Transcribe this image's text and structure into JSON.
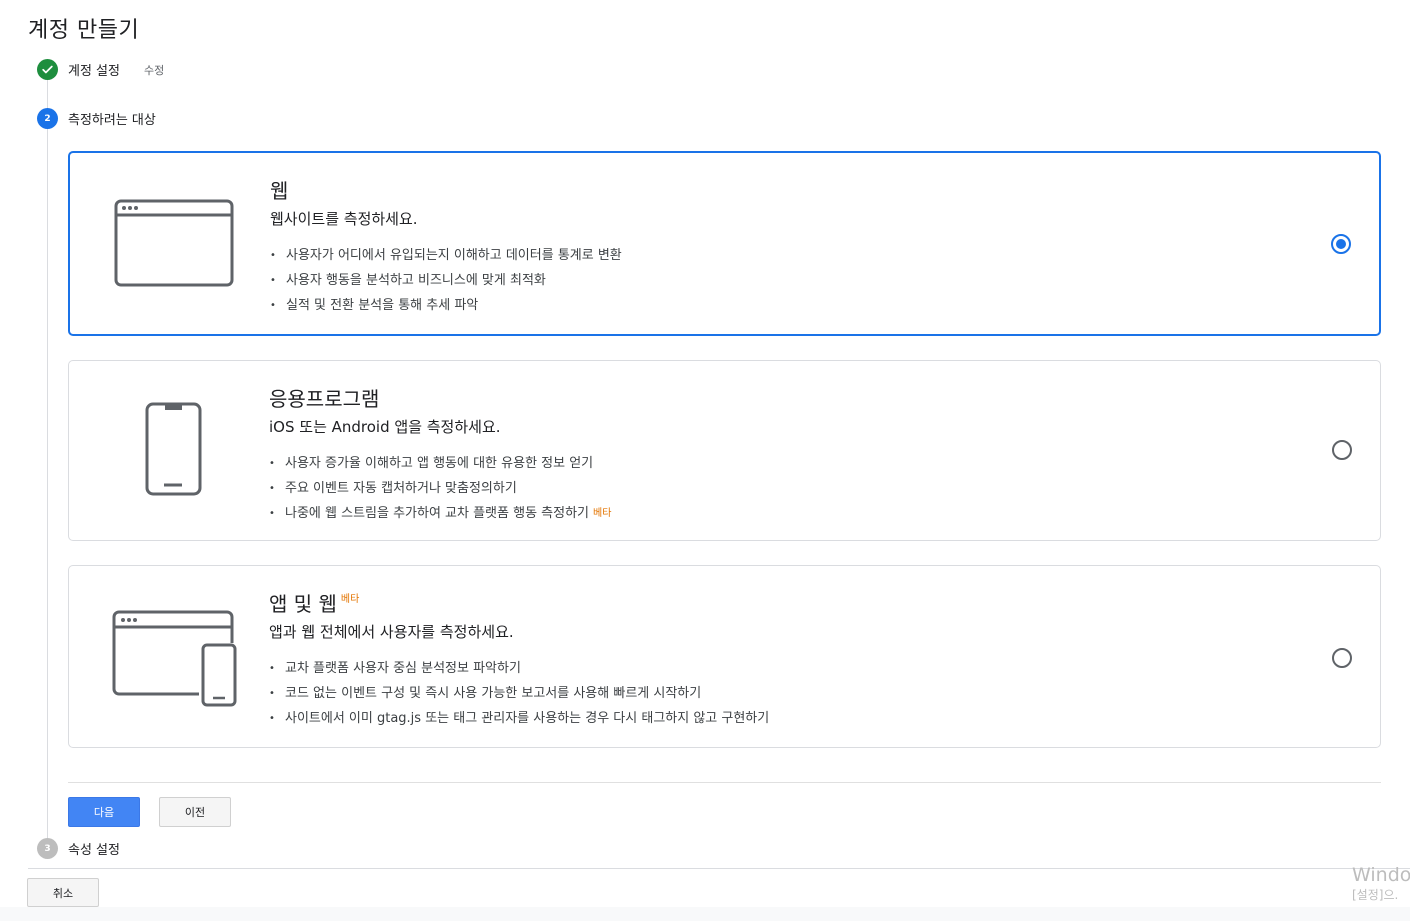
{
  "page": {
    "title": "계정 만들기"
  },
  "steps": [
    {
      "number": "✓",
      "label": "계정 설정",
      "edit": "수정",
      "status": "done"
    },
    {
      "number": "2",
      "label": "측정하려는 대상",
      "status": "active"
    },
    {
      "number": "3",
      "label": "속성 설정",
      "status": "pending"
    }
  ],
  "options": {
    "web": {
      "title": "웹",
      "subtitle": "웹사이트를 측정하세요.",
      "bullets": [
        "사용자가 어디에서 유입되는지 이해하고 데이터를 통계로 변환",
        "사용자 행동을 분석하고 비즈니스에 맞게 최적화",
        "실적 및 전환 분석을 통해 추세 파악"
      ],
      "selected": true
    },
    "app": {
      "title": "응용프로그램",
      "subtitle": "iOS 또는 Android 앱을 측정하세요.",
      "bullets": [
        "사용자 증가율 이해하고 앱 행동에 대한 유용한 정보 얻기",
        "주요 이벤트 자동 캡처하거나 맞춤정의하기",
        "나중에 웹 스트림을 추가하여 교차 플랫폼 행동 측정하기"
      ],
      "bullet_badge": "베타",
      "selected": false
    },
    "app_web": {
      "title": "앱 및 웹",
      "badge": "베타",
      "subtitle": "앱과 웹 전체에서 사용자를 측정하세요.",
      "bullets": [
        "교차 플랫폼 사용자 중심 분석정보 파악하기",
        "코드 없는 이벤트 구성 및 즉시 사용 가능한 보고서를 사용해 빠르게 시작하기",
        "사이트에서 이미 gtag.js 또는 태그 관리자를 사용하는 경우 다시 태그하지 않고 구현하기"
      ],
      "selected": false
    }
  },
  "buttons": {
    "next": "다음",
    "prev": "이전",
    "cancel": "취소"
  },
  "watermark": {
    "line1": "Windo",
    "line2": "[설정]으."
  },
  "colors": {
    "accent": "#1a73e8",
    "done": "#1e8e3e",
    "beta": "#e37400",
    "button": "#4285f4"
  }
}
